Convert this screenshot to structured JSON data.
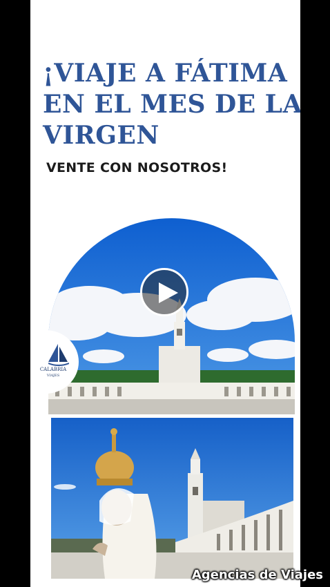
{
  "headline": {
    "line1": "¡VIAJE A FÁTIMA",
    "line2": "EN EL MES DE LA",
    "line3": "VIRGEN"
  },
  "subtitle": "VENTE CON NOSOTROS!",
  "logo": {
    "name": "CALABRIA",
    "tagline": "VIAJES"
  },
  "play_icon": "play-icon",
  "watermark": "Agencias de Viajes",
  "colors": {
    "headline": "#2f5597",
    "sky": "#1f74d6",
    "background": "#ffffff",
    "frame": "#000000"
  }
}
